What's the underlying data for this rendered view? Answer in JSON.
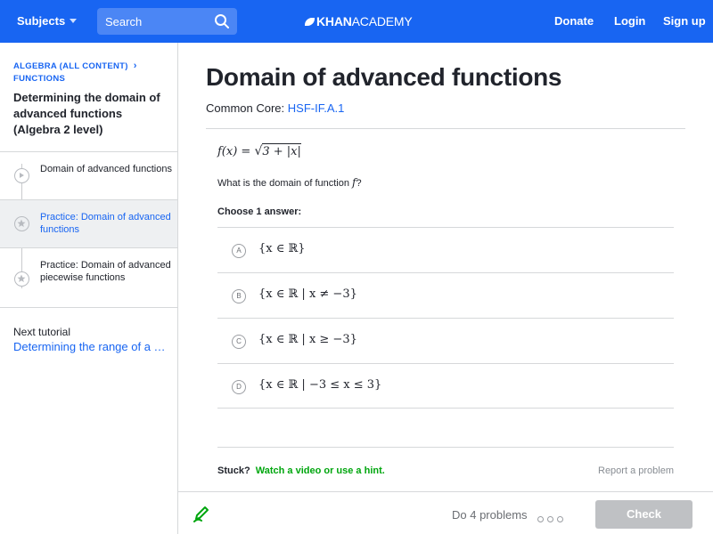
{
  "header": {
    "subjects_label": "Subjects",
    "search_placeholder": "Search",
    "logo_bold": "KHAN",
    "logo_light": "ACADEMY",
    "donate": "Donate",
    "login": "Login",
    "signup": "Sign up",
    "bar_color": "#1865f2"
  },
  "sidebar": {
    "breadcrumb": "ALGEBRA (ALL CONTENT)",
    "breadcrumb_sub": "FUNCTIONS",
    "tutorial_title": "Determining the domain of advanced functions (Algebra 2 level)",
    "items": [
      {
        "label": "Domain of advanced functions",
        "type": "video",
        "active": false
      },
      {
        "label": "Practice: Domain of advanced functions",
        "type": "exercise",
        "active": true
      },
      {
        "label": "Practice: Domain of advanced piecewise functions",
        "type": "exercise",
        "active": false
      }
    ],
    "next_label": "Next tutorial",
    "next_link": "Determining the range of a …"
  },
  "main": {
    "title": "Domain of advanced functions",
    "common_core_label": "Common Core:",
    "common_core_code": "HSF-IF.A.1",
    "function_lhs": "f(x) = ",
    "function_radicand": "3 + |x|",
    "question_prefix": "What is the domain of function ",
    "question_var": "f",
    "question_suffix": "?",
    "choose": "Choose 1 answer:",
    "choices": [
      {
        "letter": "A",
        "text": "{x ∈ ℝ}"
      },
      {
        "letter": "B",
        "text": "{x ∈ ℝ | x ≠ −3}"
      },
      {
        "letter": "C",
        "text": "{x ∈ ℝ | x ≥ −3}"
      },
      {
        "letter": "D",
        "text": "{x ∈ ℝ | −3 ≤ x ≤ 3}"
      }
    ],
    "stuck": "Stuck?",
    "hint_link": "Watch a video or use a hint.",
    "report": "Report a problem"
  },
  "footer": {
    "problems": "Do 4 problems",
    "check": "Check"
  }
}
